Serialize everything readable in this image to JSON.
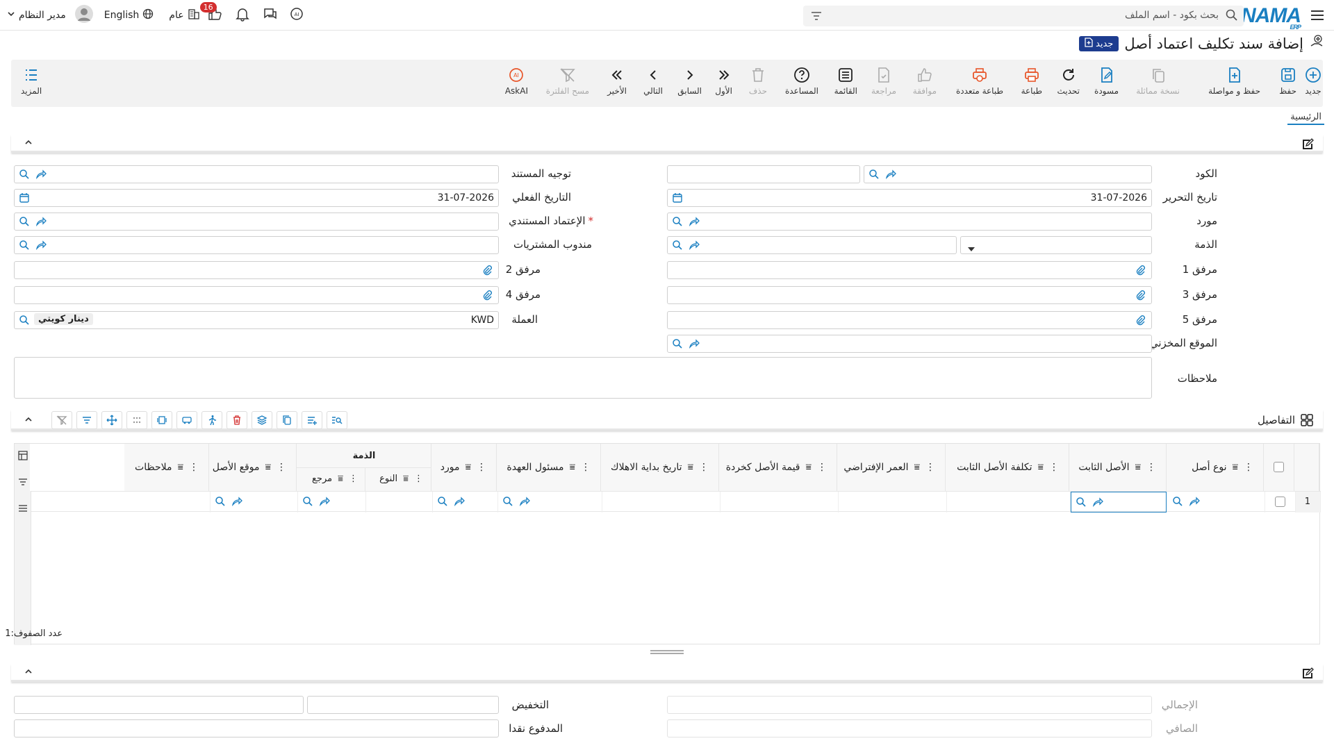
{
  "app": {
    "logo": "NAMA",
    "logo_sub": "ERP"
  },
  "search": {
    "placeholder": "بحث بكود - اسم الملف"
  },
  "topbar": {
    "user": "مدير النظام",
    "language": "English",
    "year": "عام",
    "notif_count": "16"
  },
  "page": {
    "title": "إضافة سند تكليف اعتماد أصل",
    "badge": "جديد"
  },
  "toolbar": {
    "new": "جديد",
    "save": "حفظ",
    "save_continue": "حفظ و مواصلة",
    "copy": "نسخة مماثلة",
    "draft": "مسودة",
    "refresh": "تحديث",
    "print": "طباعة",
    "multi_print": "طباعة متعددة",
    "approve": "موافقة",
    "review": "مراجعة",
    "list": "القائمة",
    "help": "المساعدة",
    "delete": "حذف",
    "first": "الأول",
    "previous": "السابق",
    "next": "التالي",
    "last": "الأخير",
    "clear_filter": "مسح الفلترة",
    "askai": "AskAI",
    "more": "المزيد"
  },
  "tabs": {
    "main": "الرئيسية"
  },
  "form": {
    "code": "الكود",
    "doc_direction": "توجيه المستند",
    "edit_date": "تاريخ التحرير",
    "edit_date_value": "31-07-2026",
    "actual_date": "التاريخ الفعلي",
    "actual_date_value": "31-07-2026",
    "supplier": "مورد",
    "doc_credit": "الإعتماد المستندي",
    "liability": "الذمة",
    "purchase_rep": "مندوب المشتريات",
    "att1": "مرفق 1",
    "att2": "مرفق 2",
    "att3": "مرفق 3",
    "att4": "مرفق 4",
    "att5": "مرفق 5",
    "currency": "العملة",
    "currency_code": "KWD",
    "currency_name": "دينار كويتي",
    "warehouse": "الموقع المخزني",
    "notes": "ملاحظات"
  },
  "details": {
    "title": "التفاصيل",
    "columns": {
      "asset_type": "نوع أصل",
      "fixed_asset": "الأصل الثابت",
      "fixed_asset_cost": "تكلفة الأصل الثابت",
      "default_age": "العمر الإفتراضي",
      "scrap_value": "قيمة الأصل كخردة",
      "depr_start": "تاريخ بداية الاهلاك",
      "custodian": "مسئول العهدة",
      "supplier": "مورد",
      "liability": "الذمة",
      "type": "النوع",
      "reference": "مرجع",
      "asset_location": "موقع الأصل",
      "notes": "ملاحظات"
    },
    "rows": [
      {
        "num": "1"
      }
    ],
    "row_count_label": "عدد الصفوف:",
    "row_count": "1"
  },
  "summary": {
    "total": "الإجمالي",
    "discount": "التخفيض",
    "net": "الصافي",
    "paid_cash": "المدفوع نقدا"
  },
  "colors": {
    "accent": "#1a7fc1",
    "badge": "#1d3c8f",
    "print": "#e8562a",
    "danger": "#d32f2f"
  }
}
